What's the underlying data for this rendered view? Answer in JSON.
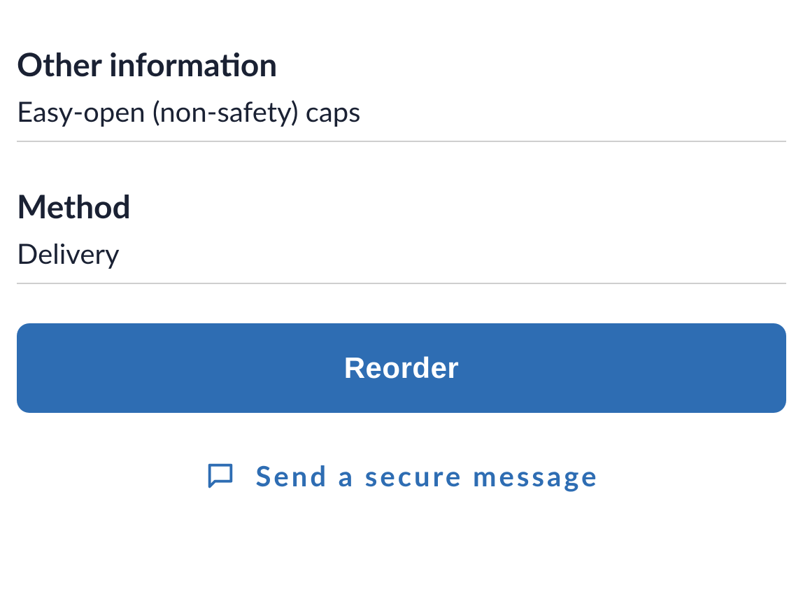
{
  "sections": [
    {
      "title": "Other information",
      "value": "Easy-open (non-safety) caps"
    },
    {
      "title": "Method",
      "value": "Delivery"
    }
  ],
  "actions": {
    "reorder_label": "Reorder",
    "secure_message_label": "Send a secure message"
  },
  "colors": {
    "primary": "#2e6db3",
    "text_dark": "#1a2133"
  }
}
